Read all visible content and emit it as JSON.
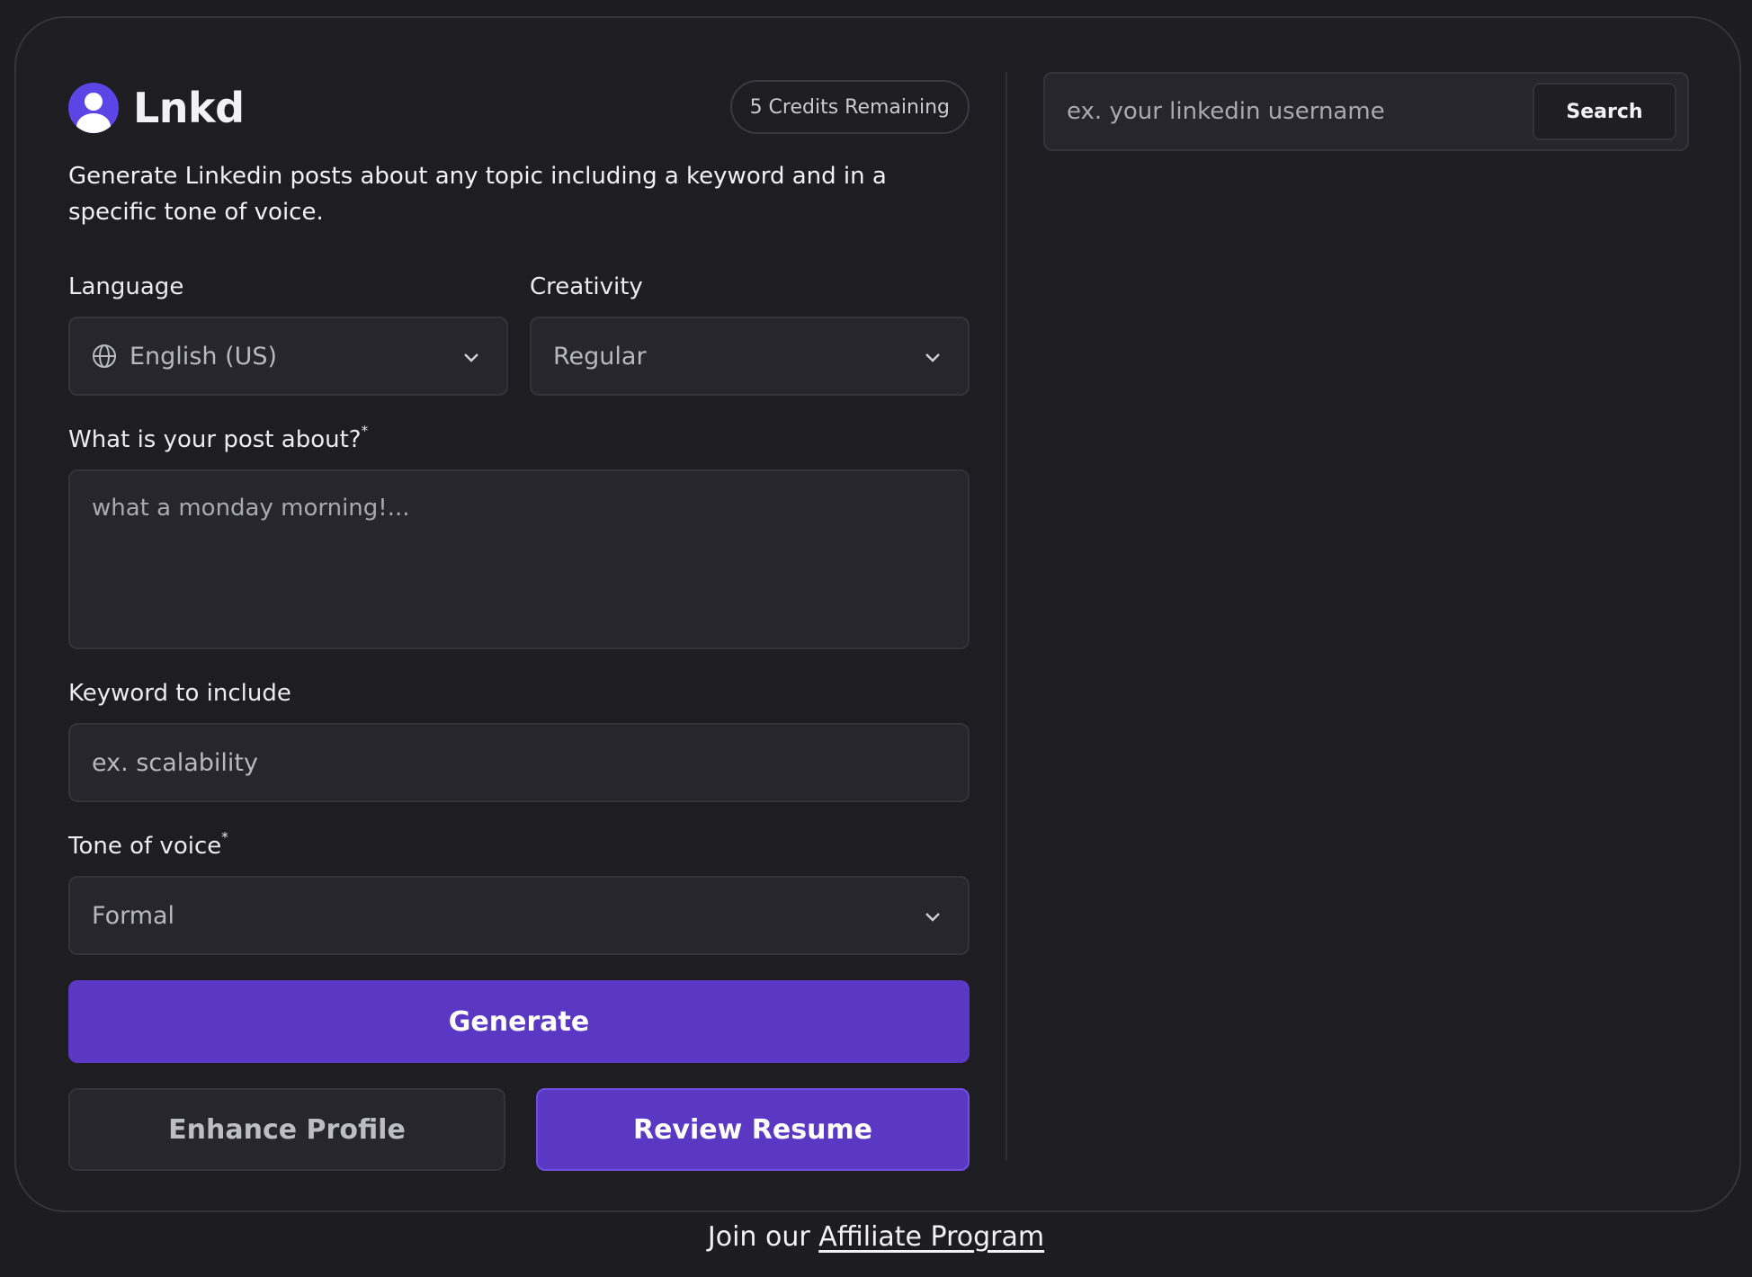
{
  "brand": {
    "name": "Lnkd",
    "icon": "user-avatar-icon",
    "accent": "#5b45e6"
  },
  "credits": {
    "label": "5 Credits Remaining"
  },
  "intro": "Generate Linkedin posts about any topic including a keyword and in a specific tone of voice.",
  "form": {
    "language": {
      "label": "Language",
      "value": "English (US)",
      "icon": "globe-icon"
    },
    "creativity": {
      "label": "Creativity",
      "value": "Regular"
    },
    "topic": {
      "label": "What is your post about?",
      "required_mark": "*",
      "placeholder": "what a monday morning!..."
    },
    "keyword": {
      "label": "Keyword to include",
      "placeholder": "ex. scalability"
    },
    "tone": {
      "label": "Tone of voice",
      "required_mark": "*",
      "value": "Formal"
    }
  },
  "actions": {
    "generate": "Generate",
    "enhance_profile": "Enhance Profile",
    "review_resume": "Review Resume"
  },
  "search": {
    "placeholder": "ex. your linkedin username",
    "button": "Search"
  },
  "footer": {
    "prefix": "Join our ",
    "link": "Affiliate Program"
  },
  "colors": {
    "background": "#1c1c21",
    "primary": "#5b38c4",
    "field": "#26262c"
  }
}
